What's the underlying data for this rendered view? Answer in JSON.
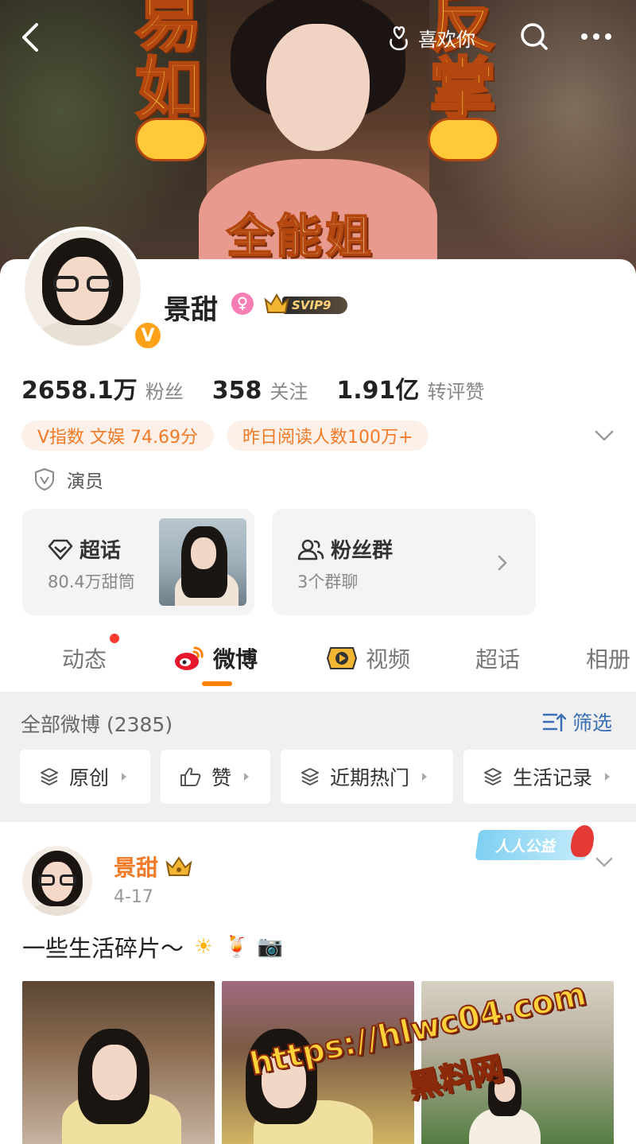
{
  "header": {
    "like_label": "喜欢你"
  },
  "banner": {
    "char_top_left": "易",
    "char_mid_left": "如",
    "char_top_right": "反",
    "char_mid_right": "掌",
    "slogan": "全能姐"
  },
  "profile": {
    "name": "景甜",
    "gender_icon": "female-icon",
    "vip_label": "SVIP9",
    "verified_badge": "V",
    "stats": [
      {
        "value": "2658.1万",
        "label": "粉丝"
      },
      {
        "value": "358",
        "label": "关注"
      },
      {
        "value": "1.91亿",
        "label": "转评赞"
      }
    ],
    "tags": [
      "V指数 文娱 74.69分",
      "昨日阅读人数100万+"
    ],
    "role": "演员"
  },
  "features": {
    "supertopic": {
      "title": "超话",
      "subtitle": "80.4万甜筒"
    },
    "fangroup": {
      "title": "粉丝群",
      "subtitle": "3个群聊"
    }
  },
  "tabs": [
    {
      "label": "动态",
      "has_dot": true
    },
    {
      "label": "微博",
      "active": true
    },
    {
      "label": "视频"
    },
    {
      "label": "超话"
    },
    {
      "label": "相册"
    }
  ],
  "filter": {
    "all_count": "全部微博 (2385)",
    "filter_label": "筛选",
    "chips": [
      "原创",
      "赞",
      "近期热门",
      "生活记录"
    ]
  },
  "post": {
    "author": "景甜",
    "date": "4-17",
    "text": "一些生活碎片～",
    "emojis": [
      "☀",
      "🍹",
      "📷"
    ],
    "badge": "人人公益"
  },
  "watermark": {
    "url": "https://hlwc04.com",
    "site": "黑料网"
  },
  "colors": {
    "accent": "#ff8200",
    "tag_text": "#f07a28",
    "tag_bg": "#fdf0e8",
    "link_blue": "#3a6fb5",
    "vip_gold": "#ffa21a"
  }
}
